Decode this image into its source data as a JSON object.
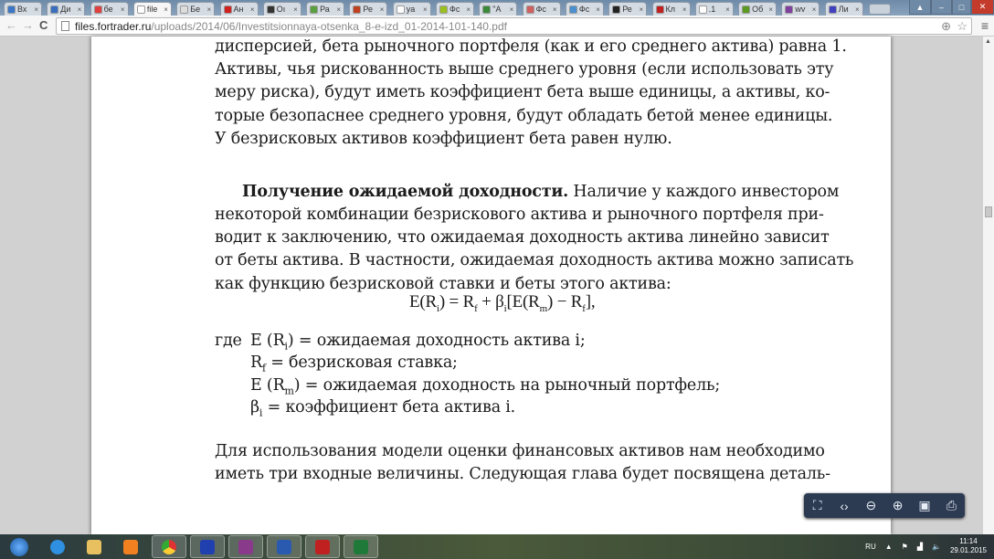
{
  "browser": {
    "tabs": [
      {
        "label": "Вх",
        "color": "#3b78c8"
      },
      {
        "label": "Ди",
        "color": "#3a6fc0"
      },
      {
        "label": "бе",
        "color": "#e04040"
      },
      {
        "label": "file",
        "color": "#ffffff",
        "active": true
      },
      {
        "label": "Бе",
        "color": "#dddddd"
      },
      {
        "label": "Ан",
        "color": "#d02020"
      },
      {
        "label": "Оı",
        "color": "#333333"
      },
      {
        "label": "Ра",
        "color": "#5aa040"
      },
      {
        "label": "Ре",
        "color": "#c04020"
      },
      {
        "label": "ya",
        "color": "#ffffff"
      },
      {
        "label": "Фс",
        "color": "#9ac020"
      },
      {
        "label": "\"А",
        "color": "#3a8a3a"
      },
      {
        "label": "Фс",
        "color": "#d06060"
      },
      {
        "label": "Фс",
        "color": "#4a90d0"
      },
      {
        "label": "Ре",
        "color": "#222222"
      },
      {
        "label": "Кл",
        "color": "#c02020"
      },
      {
        "label": ".1",
        "color": "#ffffff"
      },
      {
        "label": "Об",
        "color": "#5a9a20"
      },
      {
        "label": "wv",
        "color": "#8040a0"
      },
      {
        "label": "Ли",
        "color": "#4040c0"
      }
    ],
    "close_glyph": "×",
    "url_host": "files.fortrader.ru",
    "url_path": "/uploads/2014/06/Investitsionnaya-otsenka_8-e-izd_01-2014-101-140.pdf"
  },
  "document": {
    "para1": [
      "дисперсией, бета рыночного портфеля (как и его среднего актива) равна 1.",
      "Активы, чья рискованность выше среднего уровня (если использовать эту",
      "меру риска), будут иметь коэффициент бета выше единицы, а активы, ко-",
      "торые безопаснее среднего уровня, будут обладать бетой менее единицы.",
      "У безрисковых активов коэффициент бета равен нулю."
    ],
    "heading": "Получение ожидаемой доходности.",
    "para2_first": " Наличие у каждого инвестором",
    "para2": [
      "некоторой комбинации безрискового актива и рыночного портфеля при-",
      "водит к заключению, что ожидаемая доходность актива линейно зависит",
      "от беты актива. В частности, ожидаемая доходность актива можно записать",
      "как функцию безрисковой ставки и беты этого актива:"
    ],
    "formula": "E(Rᵢ) = R_f + βᵢ[E(R_m) − R_f],",
    "where": "где",
    "defs": [
      {
        "sym": "E (R",
        "sub": "i",
        "rest": ") = ожидаемая доходность актива i;"
      },
      {
        "sym": "R",
        "sub": "f",
        "rest": " = безрисковая ставка;"
      },
      {
        "sym": "E (R",
        "sub": "m",
        "rest": ") = ожидаемая доходность на рыночный портфель;"
      },
      {
        "sym": "β",
        "sub": "i",
        "rest": " = коэффициент бета актива i."
      }
    ],
    "para3": [
      "Для использования модели оценки финансовых активов нам необходимо",
      "иметь три входные величины. Следующая глава будет посвящена деталь-"
    ]
  },
  "system": {
    "lang": "RU",
    "time": "11:14",
    "date": "29.01.2015"
  }
}
